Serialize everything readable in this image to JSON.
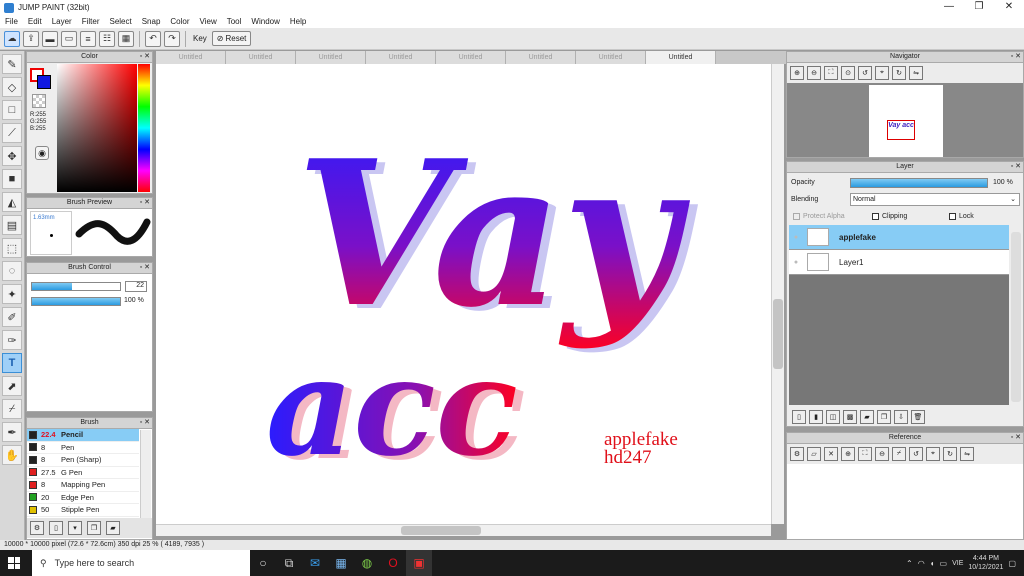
{
  "window": {
    "title": "JUMP PAINT (32bit)",
    "minimize": "—",
    "restore": "❐",
    "close": "✕"
  },
  "menu": [
    "File",
    "Edit",
    "Layer",
    "Filter",
    "Select",
    "Snap",
    "Color",
    "View",
    "Tool",
    "Window",
    "Help"
  ],
  "toolbar": {
    "key_label": "Key",
    "reset_label": "Reset"
  },
  "tabs": [
    "Untitled",
    "Untitled",
    "Untitled",
    "Untitled",
    "Untitled",
    "Untitled",
    "Untitled",
    "Untitled"
  ],
  "color_panel": {
    "title": "Color",
    "r": "R:255",
    "g": "G:255",
    "b": "B:255"
  },
  "brush_preview": {
    "title": "Brush Preview",
    "size": "1.63mm"
  },
  "brush_control": {
    "title": "Brush Control",
    "size_value": "22",
    "size_fill": 0.45,
    "opacity_value": "100 %",
    "opacity_fill": 1.0
  },
  "brush_panel": {
    "title": "Brush",
    "items": [
      {
        "size": "22.4",
        "name": "Pencil",
        "color": "#222222",
        "selected": true
      },
      {
        "size": "8",
        "name": "Pen",
        "color": "#222222",
        "selected": false
      },
      {
        "size": "8",
        "name": "Pen (Sharp)",
        "color": "#222222",
        "selected": false
      },
      {
        "size": "27.5",
        "name": "G Pen",
        "color": "#e02020",
        "selected": false
      },
      {
        "size": "8",
        "name": "Mapping Pen",
        "color": "#e02020",
        "selected": false
      },
      {
        "size": "20",
        "name": "Edge Pen",
        "color": "#20a020",
        "selected": false
      },
      {
        "size": "50",
        "name": "Stipple Pen",
        "color": "#e0c000",
        "selected": false
      }
    ]
  },
  "navigator": {
    "title": "Navigator",
    "thumb_text": "Vay acc"
  },
  "layer_panel": {
    "title": "Layer",
    "opacity_label": "Opacity",
    "opacity_value": "100 %",
    "blending_label": "Blending",
    "blending_value": "Normal",
    "protect_alpha": "Protect Alpha",
    "clipping": "Clipping",
    "lock": "Lock",
    "layers": [
      {
        "name": "applefake",
        "selected": true
      },
      {
        "name": "Layer1",
        "selected": false
      }
    ]
  },
  "reference": {
    "title": "Reference"
  },
  "canvas_art": {
    "line1": "Vay",
    "line2": "acc",
    "sig1": "applefake",
    "sig2": "hd247"
  },
  "status": "10000 * 10000 pixel  (72.6 * 72.6cm)  350 dpi  25 %  ( 4189, 7935 )",
  "taskbar": {
    "search_placeholder": "Type here to search",
    "time": "4:44 PM",
    "date": "10/12/2021",
    "lang": "VIE"
  },
  "colors": {
    "accent": "#3b9be0",
    "selected_row": "#87ccf5",
    "grad_blue": "#2a1cff",
    "grad_red": "#ff0020"
  }
}
